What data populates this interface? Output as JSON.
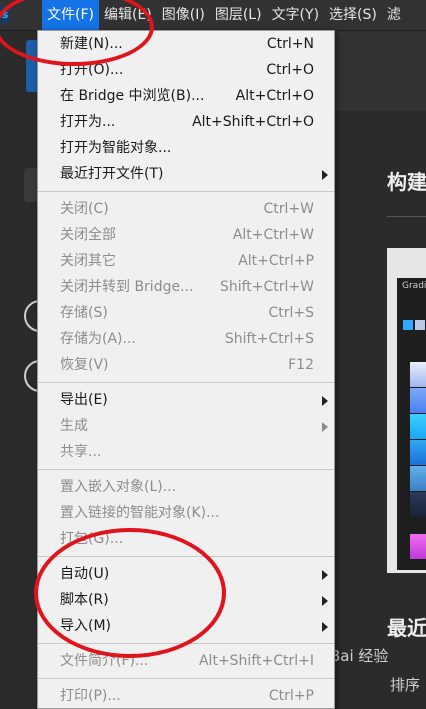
{
  "menubar": {
    "app_icon": "s",
    "items": [
      {
        "label": "文件(F)"
      },
      {
        "label": "编辑(E)"
      },
      {
        "label": "图像(I)"
      },
      {
        "label": "图层(L)"
      },
      {
        "label": "文字(Y)"
      },
      {
        "label": "选择(S)"
      },
      {
        "label": "滤"
      }
    ]
  },
  "file_menu": {
    "groups": [
      [
        {
          "label": "新建(N)...",
          "shortcut": "Ctrl+N",
          "enabled": true
        },
        {
          "label": "打开(O)...",
          "shortcut": "Ctrl+O",
          "enabled": true
        },
        {
          "label": "在 Bridge 中浏览(B)...",
          "shortcut": "Alt+Ctrl+O",
          "enabled": true
        },
        {
          "label": "打开为...",
          "shortcut": "Alt+Shift+Ctrl+O",
          "enabled": true
        },
        {
          "label": "打开为智能对象...",
          "shortcut": "",
          "enabled": true
        },
        {
          "label": "最近打开文件(T)",
          "shortcut": "",
          "enabled": true,
          "submenu": true
        }
      ],
      [
        {
          "label": "关闭(C)",
          "shortcut": "Ctrl+W",
          "enabled": false
        },
        {
          "label": "关闭全部",
          "shortcut": "Alt+Ctrl+W",
          "enabled": false
        },
        {
          "label": "关闭其它",
          "shortcut": "Alt+Ctrl+P",
          "enabled": false
        },
        {
          "label": "关闭并转到 Bridge...",
          "shortcut": "Shift+Ctrl+W",
          "enabled": false
        },
        {
          "label": "存储(S)",
          "shortcut": "Ctrl+S",
          "enabled": false
        },
        {
          "label": "存储为(A)...",
          "shortcut": "Shift+Ctrl+S",
          "enabled": false
        },
        {
          "label": "恢复(V)",
          "shortcut": "F12",
          "enabled": false
        }
      ],
      [
        {
          "label": "导出(E)",
          "shortcut": "",
          "enabled": true,
          "submenu": true
        },
        {
          "label": "生成",
          "shortcut": "",
          "enabled": false,
          "submenu": true
        },
        {
          "label": "共享...",
          "shortcut": "",
          "enabled": false
        }
      ],
      [
        {
          "label": "置入嵌入对象(L)...",
          "shortcut": "",
          "enabled": false
        },
        {
          "label": "置入链接的智能对象(K)...",
          "shortcut": "",
          "enabled": false
        },
        {
          "label": "打包(G)...",
          "shortcut": "",
          "enabled": false
        }
      ],
      [
        {
          "label": "自动(U)",
          "shortcut": "",
          "enabled": true,
          "submenu": true
        },
        {
          "label": "脚本(R)",
          "shortcut": "",
          "enabled": true,
          "submenu": true
        },
        {
          "label": "导入(M)",
          "shortcut": "",
          "enabled": true,
          "submenu": true
        }
      ],
      [
        {
          "label": "文件简介(F)...",
          "shortcut": "Alt+Shift+Ctrl+I",
          "enabled": false
        }
      ],
      [
        {
          "label": "打印(P)...",
          "shortcut": "Ctrl+P",
          "enabled": false
        }
      ]
    ]
  },
  "background": {
    "heading_1": "构建",
    "heading_2": "最近",
    "gradient_panel_title": "Gradi",
    "watermark": "Bai 经验",
    "watermark_2": "排序"
  },
  "colors": {
    "menu_active": "#1473e6",
    "annotation_red": "#e0141c",
    "menu_bg": "#f0f0f0",
    "app_bg": "#2b2b2b"
  }
}
